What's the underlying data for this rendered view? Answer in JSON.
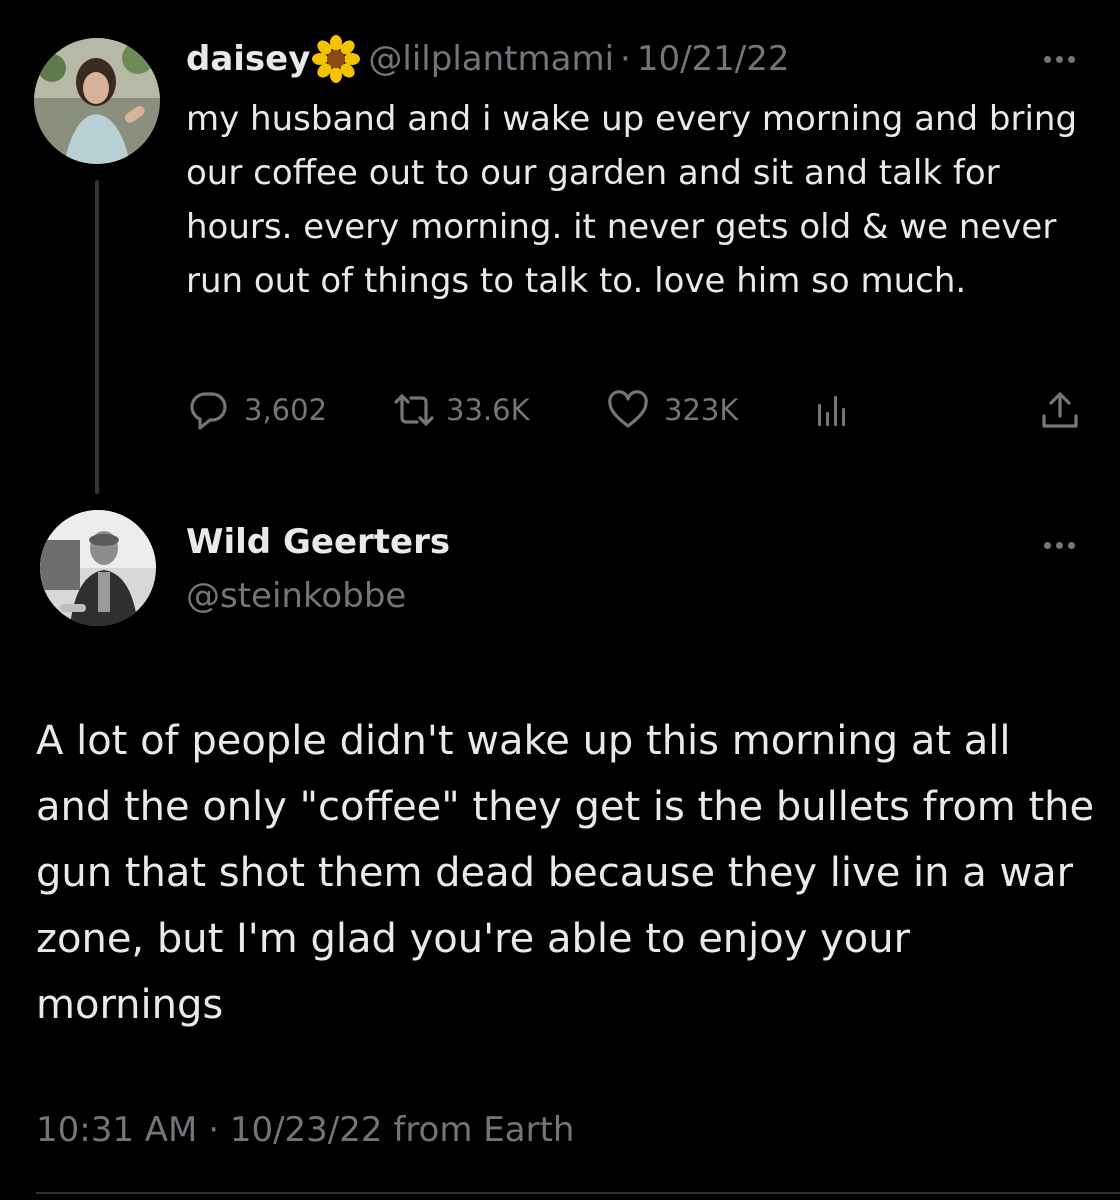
{
  "original_tweet": {
    "author_name": "daisey",
    "name_emoji_icon": "sunflower-emoji-icon",
    "handle": "@lilplantmami",
    "separator": "·",
    "date": "10/21/22",
    "text": "my husband and i wake up every morning and bring our coffee out to our garden and sit and talk for hours. every morning. it never gets old & we never run out of things to talk to. love him so much.",
    "replies_count": "3,602",
    "retweets_count": "33.6K",
    "likes_count": "323K"
  },
  "reply_tweet": {
    "author_name": "Wild Geerters",
    "handle": "@steinkobbe",
    "text": "A lot of people didn't wake up this morning at all and the only \"coffee\" they get is the bullets from the gun that shot them dead because they live in a war zone, but I'm glad you're able to enjoy your mornings",
    "time": "10:31 AM",
    "separator": "·",
    "date": "10/23/22",
    "source": "from Earth"
  },
  "icons": {
    "reply": "speech-bubble-icon",
    "retweet": "retweet-arrows-icon",
    "like": "heart-icon",
    "views": "bar-chart-icon",
    "share": "share-upload-icon",
    "more": "more-dots-icon"
  },
  "colors": {
    "background": "#000000",
    "primary_text": "#e7e9ea",
    "secondary_text": "#71767b",
    "thread_line": "#333639"
  }
}
